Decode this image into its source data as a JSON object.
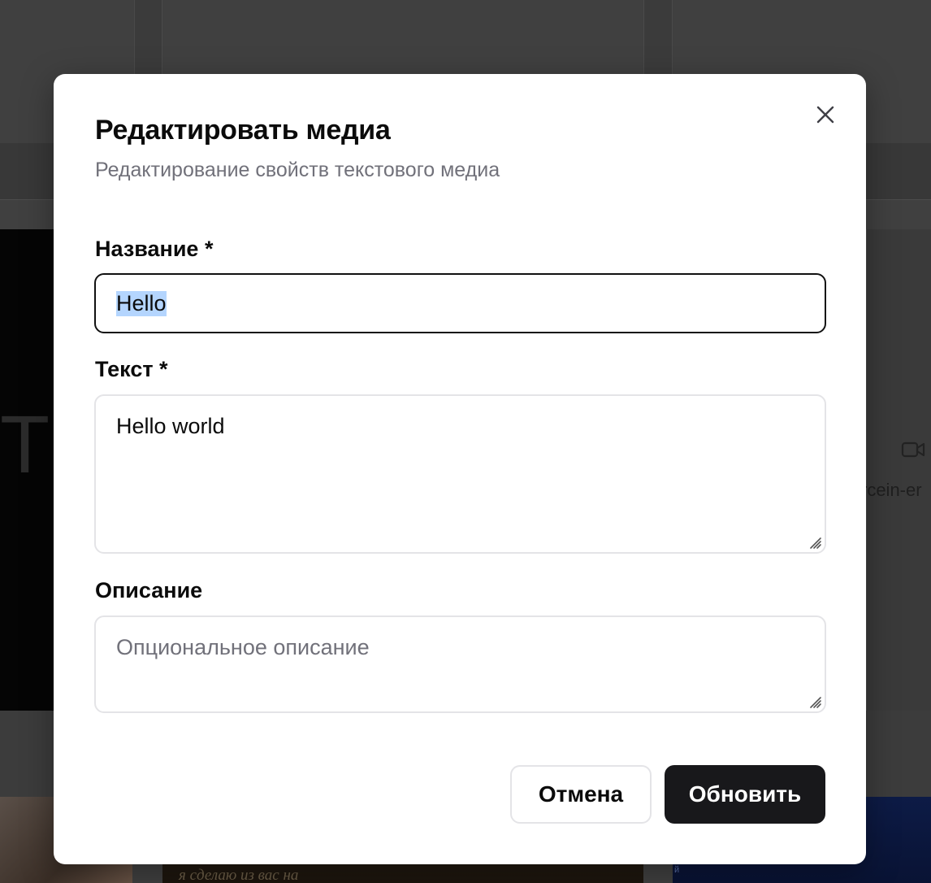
{
  "background": {
    "filename_fragment": "rcein-er",
    "thumb_caption": "я сделаю из вас на",
    "thumb3_caption": "й"
  },
  "modal": {
    "title": "Редактировать медиа",
    "subtitle": "Редактирование свойств текстового медиа",
    "close_icon": "close-icon",
    "fields": {
      "name": {
        "label": "Название *",
        "value": "Hello"
      },
      "text": {
        "label": "Текст *",
        "value": "Hello world"
      },
      "description": {
        "label": "Описание",
        "value": "",
        "placeholder": "Опциональное описание"
      }
    },
    "buttons": {
      "cancel": "Отмена",
      "submit": "Обновить"
    }
  },
  "colors": {
    "primary": "#18181b",
    "muted_text": "#71717a",
    "border": "#e4e4e7",
    "selection": "#b4d5fe",
    "overlay": "#404040"
  }
}
